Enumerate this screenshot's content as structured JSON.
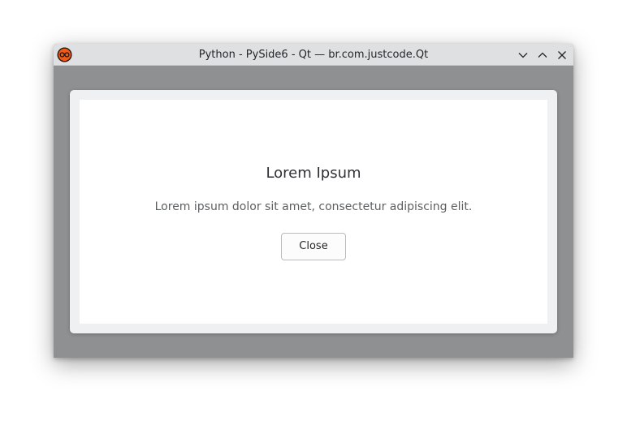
{
  "window": {
    "title": "Python - PySide6 - Qt — br.com.justcode.Qt",
    "icon": "python-app-icon",
    "controls": [
      "minimize-icon",
      "maximize-icon",
      "close-icon"
    ]
  },
  "dialog": {
    "title": "Lorem Ipsum",
    "message": "Lorem ipsum dolor sit amet, consectetur adipiscing elit.",
    "close_label": "Close"
  },
  "colors": {
    "window_background": "#8f9091",
    "titlebar": "#dee0e2",
    "card_frame": "#eff0f1",
    "card_background": "#ffffff",
    "icon_accent": "#f05a14"
  }
}
